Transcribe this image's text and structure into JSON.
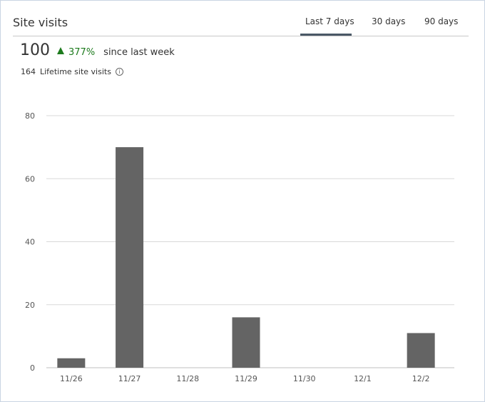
{
  "card": {
    "title": "Site visits",
    "tabs": [
      {
        "label": "Last 7 days",
        "selected": true
      },
      {
        "label": "30 days",
        "selected": false
      },
      {
        "label": "90 days",
        "selected": false
      }
    ],
    "metric": {
      "value": "100",
      "change": "377%",
      "since_label": "since last week"
    },
    "lifetime": {
      "value": "164",
      "label": "Lifetime site visits",
      "info_icon": "info-icon"
    }
  },
  "colors": {
    "bar": "#646464",
    "grid": "#d9d9d9",
    "positive": "#1e7b1e",
    "tab_underline": "#4a5866"
  },
  "chart_data": {
    "type": "bar",
    "categories": [
      "11/26",
      "11/27",
      "11/28",
      "11/29",
      "11/30",
      "12/1",
      "12/2"
    ],
    "values": [
      3,
      70,
      0,
      16,
      0,
      0,
      11
    ],
    "title": "",
    "xlabel": "",
    "ylabel": "",
    "ylim": [
      0,
      80
    ],
    "yticks": [
      0,
      20,
      40,
      60,
      80
    ],
    "grid": true
  }
}
